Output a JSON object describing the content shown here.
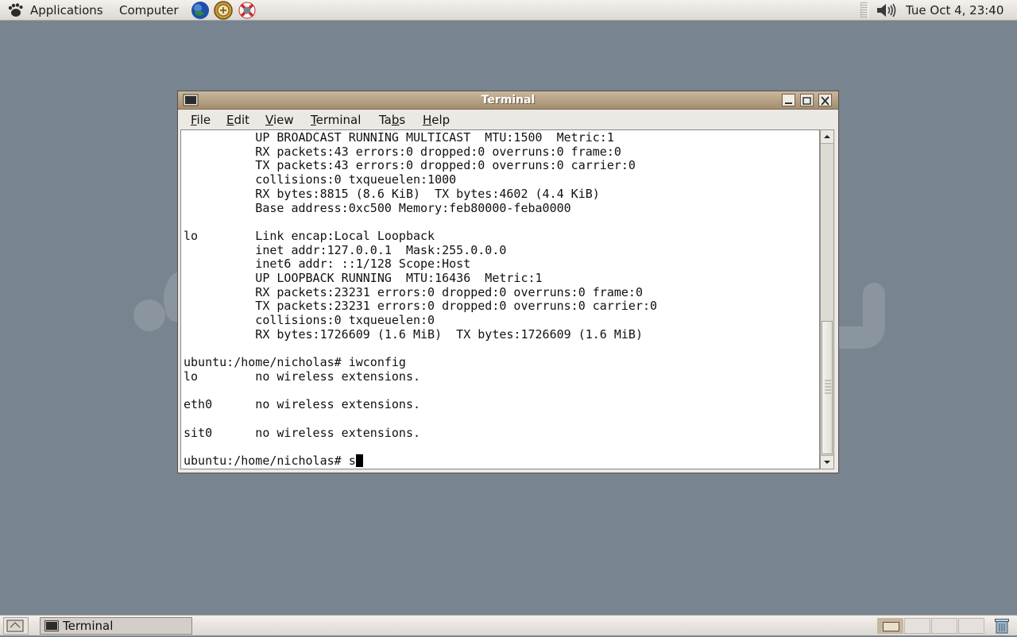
{
  "top_panel": {
    "applications_label": "Applications",
    "computer_label": "Computer",
    "clock": "Tue Oct  4, 23:40"
  },
  "window": {
    "title": "Terminal",
    "menu": {
      "file": {
        "pre": "",
        "key": "F",
        "post": "ile"
      },
      "edit": {
        "pre": "",
        "key": "E",
        "post": "dit"
      },
      "view": {
        "pre": "",
        "key": "V",
        "post": "iew"
      },
      "terminal": {
        "pre": "",
        "key": "T",
        "post": "erminal"
      },
      "tabs": {
        "pre": "Ta",
        "key": "b",
        "post": "s"
      },
      "help": {
        "pre": "",
        "key": "H",
        "post": "elp"
      }
    }
  },
  "terminal": {
    "output": "          UP BROADCAST RUNNING MULTICAST  MTU:1500  Metric:1\n          RX packets:43 errors:0 dropped:0 overruns:0 frame:0\n          TX packets:43 errors:0 dropped:0 overruns:0 carrier:0\n          collisions:0 txqueuelen:1000\n          RX bytes:8815 (8.6 KiB)  TX bytes:4602 (4.4 KiB)\n          Base address:0xc500 Memory:feb80000-feba0000\n\nlo        Link encap:Local Loopback\n          inet addr:127.0.0.1  Mask:255.0.0.0\n          inet6 addr: ::1/128 Scope:Host\n          UP LOOPBACK RUNNING  MTU:16436  Metric:1\n          RX packets:23231 errors:0 dropped:0 overruns:0 frame:0\n          TX packets:23231 errors:0 dropped:0 overruns:0 carrier:0\n          collisions:0 txqueuelen:0\n          RX bytes:1726609 (1.6 MiB)  TX bytes:1726609 (1.6 MiB)\n\nubuntu:/home/nicholas# iwconfig\nlo        no wireless extensions.\n\neth0      no wireless extensions.\n\nsit0      no wireless extensions.\n\n",
    "prompt": "ubuntu:/home/nicholas# ",
    "input": "s"
  },
  "bottom_panel": {
    "task_terminal_label": "Terminal"
  },
  "colors": {
    "desktop": "#788490",
    "titlebar": "#b09a7e"
  }
}
